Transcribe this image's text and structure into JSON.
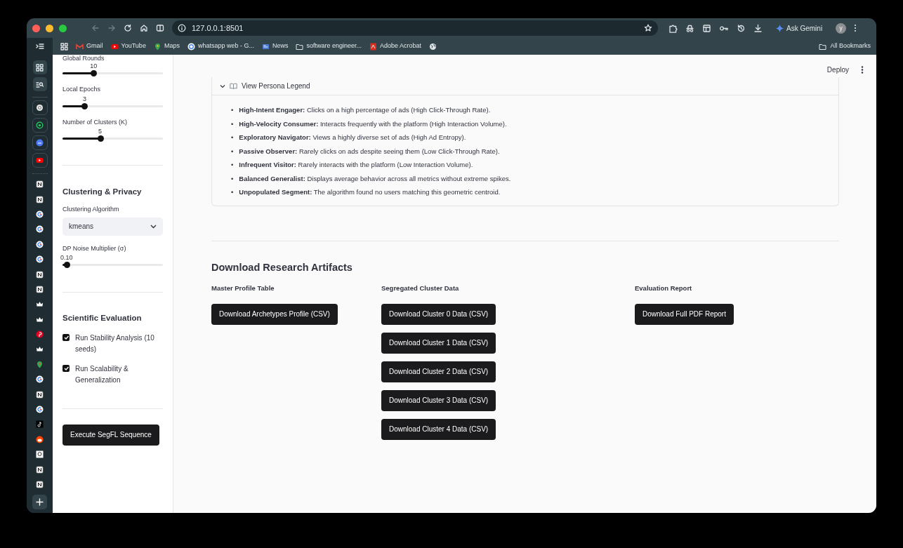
{
  "browser": {
    "address": "127.0.0.1:8501",
    "gemini_label": "Ask Gemini",
    "profile_initial": "y",
    "bookmarks": [
      {
        "label": "Gmail",
        "kind": "gmail"
      },
      {
        "label": "YouTube",
        "kind": "youtube"
      },
      {
        "label": "Maps",
        "kind": "maps"
      },
      {
        "label": "whatsapp web - G...",
        "kind": "google"
      },
      {
        "label": "News",
        "kind": "news"
      },
      {
        "label": "software engineer...",
        "kind": "folder"
      },
      {
        "label": "Adobe Acrobat",
        "kind": "acrobat"
      }
    ],
    "all_bookmarks": "All Bookmarks"
  },
  "sidebar": {
    "sliders": [
      {
        "label": "Global Rounds",
        "value": "10",
        "level": 0.31
      },
      {
        "label": "Local Epochs",
        "value": "3",
        "level": 0.22
      },
      {
        "label": "Number of Clusters (K)",
        "value": "5",
        "level": 0.375
      }
    ],
    "clustering": {
      "heading": "Clustering & Privacy",
      "algorithm": {
        "label": "Clustering Algorithm",
        "value": "kmeans"
      },
      "noise": {
        "label": "DP Noise Multiplier (σ)",
        "value": "0.10",
        "level": 0.04
      }
    },
    "evaluation": {
      "heading": "Scientific Evaluation",
      "options": [
        {
          "label": "Run Stability Analysis (10 seeds)",
          "checked": true
        },
        {
          "label": "Run Scalability & Generalization",
          "checked": true
        }
      ]
    },
    "run_button": "Execute SegFL Sequence"
  },
  "main": {
    "deploy": "Deploy",
    "legend": {
      "title": "View Persona Legend",
      "expanded": true,
      "items": [
        {
          "marker": "•",
          "text": "**High-Intent Engager:** Clicks on a high percentage of ads (High Click-Through Rate)."
        },
        {
          "marker": "•",
          "text": "**High-Velocity Consumer:** Interacts frequently with the platform (High Interaction Volume)."
        },
        {
          "marker": "•",
          "text": "**Exploratory Navigator:** Views a highly diverse set of ads (High Ad Entropy)."
        },
        {
          "marker": "•",
          "text": "**Passive Observer:** Rarely clicks on ads despite seeing them (Low Click-Through Rate)."
        },
        {
          "marker": "•",
          "text": "**Infrequent Visitor:** Rarely interacts with the platform (Low Interaction Volume)."
        },
        {
          "marker": "•",
          "text": "**Balanced Generalist:** Displays average behavior across all metrics without extreme spikes."
        },
        {
          "marker": "•",
          "text": "**Unpopulated Segment:** The algorithm found no users matching this geometric centroid."
        }
      ]
    },
    "downloads": {
      "heading": "Download Research Artifacts",
      "columns": [
        {
          "title": "Master Profile Table",
          "buttons": [
            "Download Archetypes Profile (CSV)"
          ]
        },
        {
          "title": "Segregated Cluster Data",
          "buttons": [
            "Download Cluster 0 Data (CSV)",
            "Download Cluster 1 Data (CSV)",
            "Download Cluster 2 Data (CSV)",
            "Download Cluster 3 Data (CSV)",
            "Download Cluster 4 Data (CSV)"
          ]
        },
        {
          "title": "Evaluation Report",
          "buttons": [
            "Download Full PDF Report"
          ]
        }
      ]
    }
  }
}
